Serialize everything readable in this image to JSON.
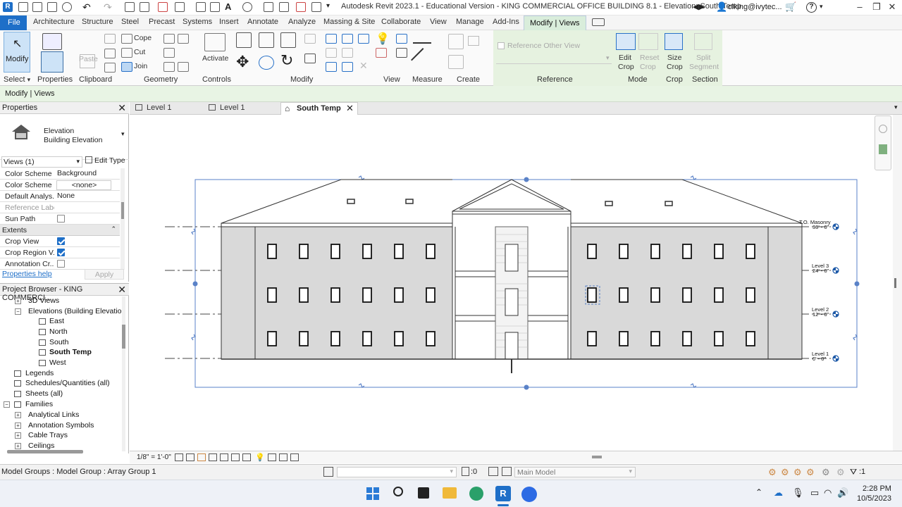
{
  "titlebar": {
    "title": "Autodesk Revit 2023.1 - Educational Version - KING COMMERCIAL OFFICE BUILDING 8.1 - Elevation: South Temp",
    "user": "clking@ivytec...",
    "help": "?"
  },
  "menu": {
    "file": "File",
    "tabs": [
      "Architecture",
      "Structure",
      "Steel",
      "Precast",
      "Systems",
      "Insert",
      "Annotate",
      "Analyze",
      "Massing & Site",
      "Collaborate",
      "View",
      "Manage",
      "Add-Ins"
    ],
    "active": "Modify | Views"
  },
  "ribbon": {
    "modify": "Modify",
    "paste": "Paste",
    "cope": "Cope",
    "cut": "Cut",
    "join": "Join",
    "activate": "Activate",
    "reference_other_view": "Reference Other View",
    "edit_crop": [
      "Edit",
      "Crop"
    ],
    "reset_crop": [
      "Reset",
      "Crop"
    ],
    "size_crop": [
      "Size",
      "Crop"
    ],
    "split_segment": [
      "Split",
      "Segment"
    ],
    "panels": {
      "select": "Select",
      "properties": "Properties",
      "clipboard": "Clipboard",
      "geometry": "Geometry",
      "controls": "Controls",
      "modify": "Modify",
      "view": "View",
      "measure": "Measure",
      "create": "Create",
      "reference": "Reference",
      "mode": "Mode",
      "crop": "Crop",
      "section": "Section"
    }
  },
  "context_line": "Modify | Views",
  "properties": {
    "header": "Properties",
    "type_name": "Elevation",
    "type_sub": "Building Elevation",
    "selector": "Views (1)",
    "edit_type": "Edit Type",
    "rows": [
      {
        "key": "Color Scheme ...",
        "value": "Background"
      },
      {
        "key": "Color Scheme",
        "value": "<none>"
      },
      {
        "key": "Default Analys...",
        "value": "None"
      },
      {
        "key": "Reference Label",
        "value": ""
      },
      {
        "key": "Sun Path",
        "value": ""
      }
    ],
    "group": "Extents",
    "extents": [
      {
        "key": "Crop View",
        "checked": true
      },
      {
        "key": "Crop Region V...",
        "checked": true
      },
      {
        "key": "Annotation Cr...",
        "checked": false
      }
    ],
    "help": "Properties help",
    "apply": "Apply"
  },
  "browser": {
    "header": "Project Browser - KING COMMERCI...",
    "items": [
      {
        "label": "3D Views",
        "type": "node"
      },
      {
        "label": "Elevations (Building Elevatio",
        "type": "node"
      },
      {
        "label": "East",
        "type": "view"
      },
      {
        "label": "North",
        "type": "view"
      },
      {
        "label": "South",
        "type": "view"
      },
      {
        "label": "South Temp",
        "type": "view",
        "selected": true
      },
      {
        "label": "West",
        "type": "view"
      },
      {
        "label": "Legends",
        "type": "root"
      },
      {
        "label": "Schedules/Quantities (all)",
        "type": "root"
      },
      {
        "label": "Sheets (all)",
        "type": "root"
      },
      {
        "label": "Families",
        "type": "root"
      },
      {
        "label": "Analytical Links",
        "type": "family"
      },
      {
        "label": "Annotation Symbols",
        "type": "family"
      },
      {
        "label": "Cable Trays",
        "type": "family"
      },
      {
        "label": "Ceilings",
        "type": "family"
      }
    ]
  },
  "view_tabs": [
    {
      "label": "Level 1"
    },
    {
      "label": "Level 1"
    },
    {
      "label": "South Temp",
      "active": true
    }
  ],
  "levels": [
    {
      "name": "T.O. Masonry",
      "elevation": "36' - 0\""
    },
    {
      "name": "Level 3",
      "elevation": "24' - 0\""
    },
    {
      "name": "Level 2",
      "elevation": "12' - 0\""
    },
    {
      "name": "Level 1",
      "elevation": "0' - 0\""
    }
  ],
  "view_control": {
    "scale": "1/8\" = 1'-0\""
  },
  "status": {
    "text": "Model Groups : Model Group : Array Group 1",
    "count": ":0",
    "model": "Main Model",
    "filter_count": ":1"
  },
  "taskbar": {
    "time": "2:28 PM",
    "date": "10/5/2023"
  },
  "colors": {
    "file_blue": "#1e6fc8",
    "ribbon_green": "#e6f2e0",
    "crop_blue": "#5a82c8",
    "wall_gray": "#d9d9d9"
  }
}
